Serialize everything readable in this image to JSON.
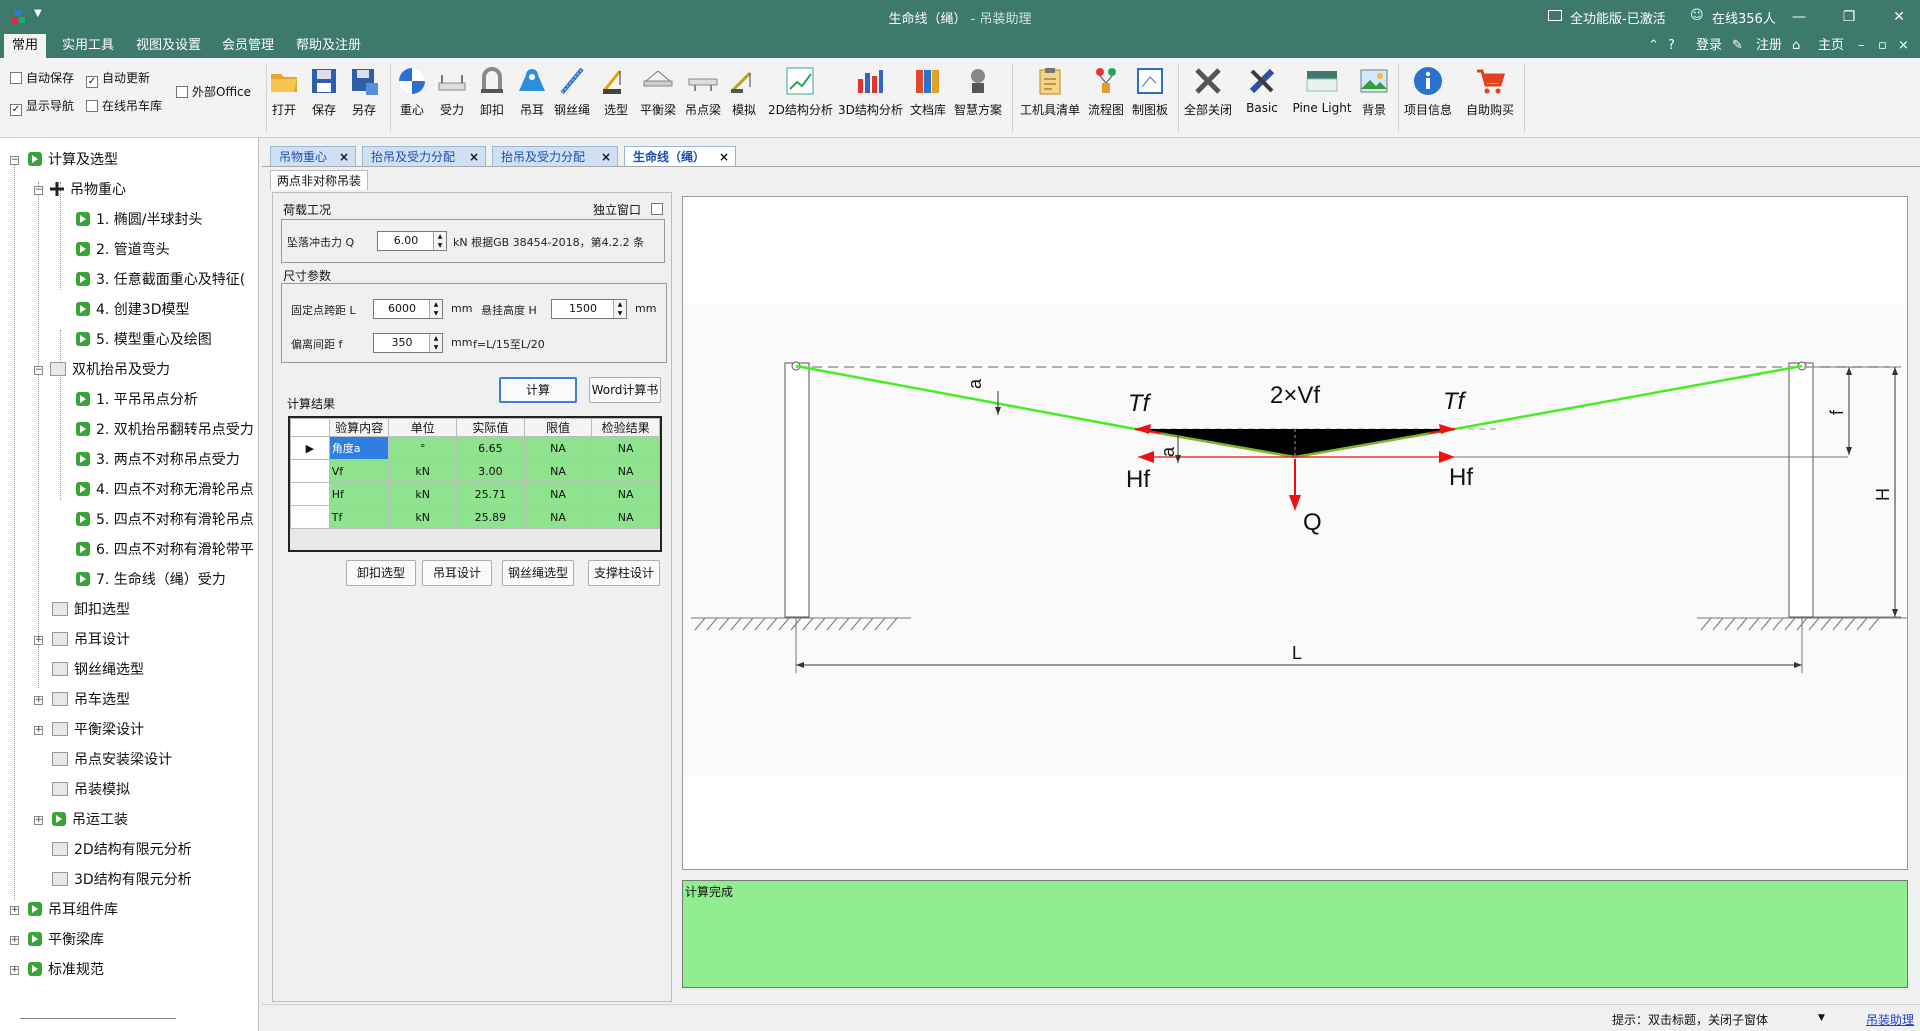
{
  "window": {
    "title": "生命线（绳）",
    "subtitle": " - 吊装助理",
    "license": "全功能版-已激活",
    "online": "在线356人"
  },
  "menu": {
    "items": [
      "常用",
      "实用工具",
      "视图及设置",
      "会员管理",
      "帮助及注册"
    ],
    "right": {
      "login": "登录",
      "register": "注册",
      "home": "主页"
    }
  },
  "ribbon": {
    "checks": [
      {
        "label": "自动保存",
        "checked": false
      },
      {
        "label": "自动更新",
        "checked": true
      },
      {
        "label": "外部Office",
        "checked": false
      },
      {
        "label": "显示导航",
        "checked": true
      },
      {
        "label": "在线吊车库",
        "checked": false
      }
    ],
    "buttons": [
      "打开",
      "保存",
      "另存",
      "重心",
      "受力",
      "卸扣",
      "吊耳",
      "钢丝绳",
      "选型",
      "平衡梁",
      "吊点梁",
      "模拟",
      "2D结构分析",
      "3D结构分析",
      "文档库",
      "智慧方案",
      "工机具清单",
      "流程图",
      "制图板",
      "全部关闭",
      "Basic",
      "Pine Light",
      "背景",
      "项目信息",
      "自助购买"
    ]
  },
  "tree": {
    "root": "计算及选型",
    "g1": "吊物重心",
    "g1_items": [
      "1. 椭圆/半球封头",
      "2. 管道弯头",
      "3. 任意截面重心及特征(",
      "4. 创建3D模型",
      "5. 模型重心及绘图"
    ],
    "g2": "双机抬吊及受力",
    "g2_items": [
      "1. 平吊吊点分析",
      "2. 双机抬吊翻转吊点受力",
      "3. 两点不对称吊点受力",
      "4. 四点不对称无滑轮吊点",
      "5. 四点不对称有滑轮吊点",
      "6. 四点不对称有滑轮带平",
      "7. 生命线（绳）受力"
    ],
    "others": [
      "卸扣选型",
      "吊耳设计",
      "钢丝绳选型",
      "吊车选型",
      "平衡梁设计",
      "吊点安装梁设计",
      "吊装模拟",
      "吊运工装",
      "2D结构有限元分析",
      "3D结构有限元分析"
    ],
    "roots": [
      "吊耳组件库",
      "平衡梁库",
      "标准规范"
    ]
  },
  "tabs": [
    "吊物重心",
    "抬吊及受力分配",
    "抬吊及受力分配",
    "生命线（绳）"
  ],
  "subtab": "两点非对称吊装",
  "load": {
    "title": "荷载工况",
    "standalone": "独立窗口",
    "q_label": "坠落冲击力 Q",
    "q_value": "6.00",
    "q_unit": "kN 根据GB 38454-2018，第4.2.2 条"
  },
  "dims": {
    "title": "尺寸参数",
    "l_label": "固定点跨距 L",
    "l_value": "6000",
    "l_unit": "mm",
    "h_label": "悬挂高度 H",
    "h_value": "1500",
    "h_unit": "mm",
    "f_label": "偏离间距 f",
    "f_value": "350",
    "f_unit": "mm",
    "f_note": "f=L/15至L/20"
  },
  "actions": {
    "calc": "计算",
    "word": "Word计算书"
  },
  "results": {
    "title": "计算结果",
    "headers": [
      "验算内容",
      "单位",
      "实际值",
      "限值",
      "检验结果"
    ],
    "rows": [
      [
        "角度a",
        "°",
        "6.65",
        "NA",
        "NA"
      ],
      [
        "Vf",
        "kN",
        "3.00",
        "NA",
        "NA"
      ],
      [
        "Hf",
        "kN",
        "25.71",
        "NA",
        "NA"
      ],
      [
        "Tf",
        "kN",
        "25.89",
        "NA",
        "NA"
      ]
    ]
  },
  "bottom_buttons": [
    "卸扣选型",
    "吊耳设计",
    "钢丝绳选型",
    "支撑柱设计"
  ],
  "diagram": {
    "labels": {
      "Tf": "Tf",
      "Hf": "Hf",
      "Vf2": "2×Vf",
      "Q": "Q",
      "a": "a",
      "f": "f",
      "H": "H",
      "L": "L"
    }
  },
  "status": "计算完成",
  "statusbar": {
    "hint": "提示：双击标题，关闭子窗体",
    "link": "吊装助理"
  },
  "colors": {
    "titlebar": "#3d7a6c",
    "rope": "#44ee22",
    "rope_mid": "#7ab52a",
    "arrow": "#ee1111",
    "status_bg": "#90ee90",
    "table_green": "#8fe38f"
  }
}
